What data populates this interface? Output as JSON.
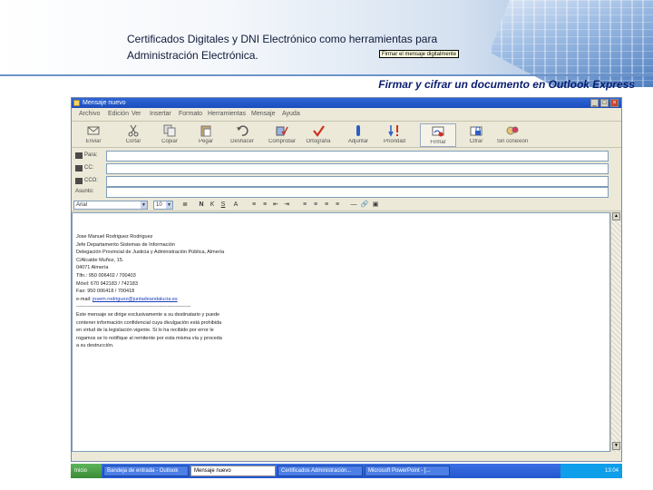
{
  "slide": {
    "title": "Certificados Digitales y DNI Electrónico como herramientas para Administración Electrónica.",
    "subtitle": "Firmar y cifrar un documento en Outlook Express"
  },
  "window": {
    "title": "Mensaje nuevo",
    "menu": [
      "Archivo",
      "Edición",
      "Ver",
      "Insertar",
      "Formato",
      "Herramientas",
      "Mensaje",
      "Ayuda"
    ],
    "toolbar": [
      {
        "label": "Enviar",
        "icon": "send-icon"
      },
      {
        "label": "Cortar",
        "icon": "scissors-icon"
      },
      {
        "label": "Copiar",
        "icon": "copy-icon"
      },
      {
        "label": "Pegar",
        "icon": "paste-icon"
      },
      {
        "label": "Deshacer",
        "icon": "undo-icon"
      },
      {
        "label": "Comprobar",
        "icon": "check-names-icon"
      },
      {
        "label": "Ortografía",
        "icon": "spelling-icon"
      },
      {
        "label": "Adjuntar",
        "icon": "attach-icon"
      },
      {
        "label": "Prioridad",
        "icon": "priority-icon"
      },
      {
        "label": "Firmar",
        "icon": "sign-icon"
      },
      {
        "label": "Cifrar",
        "icon": "encrypt-icon"
      },
      {
        "label": "Sin conexión",
        "icon": "offline-icon"
      }
    ],
    "tooltip": "Firmar el mensaje digitalmente",
    "fields": [
      {
        "label": "Para:",
        "value": ""
      },
      {
        "label": "CC:",
        "value": ""
      },
      {
        "label": "CCO:",
        "value": ""
      },
      {
        "label": "Asunto:",
        "value": ""
      }
    ],
    "format": {
      "font": "Arial",
      "size": "10"
    },
    "body": {
      "name": "Jose Manuel Rodriguez Rodriguez",
      "lines": [
        "Jefe Departamento Sistemas de Información",
        "Delegación Provincial de Justicia y Administración Pública, Almería",
        "C/Alcalde Muñoz, 15.",
        "04071 Almería",
        "Tlfn.: 950 006402 / 700403",
        "Móvil: 670 942183 / 742183",
        "Fax: 950 006418 / 700418"
      ],
      "email_label": "e-mail:",
      "email": "josem.rodriguez@juntadeandalucia.es",
      "separator": "---------------------------------------------------------------------",
      "disclaimer": [
        "Este mensaje se dirige exclusivamente a su destinatario y puede",
        "contener información confidencial cuya divulgación está prohibida",
        "en virtud de la legislación vigente. Si lo ha recibido por error le",
        "rogamos se lo notifique al remitente por esta misma vía y proceda",
        "a su destrucción."
      ]
    }
  },
  "taskbar": {
    "start": "Inicio",
    "tasks": [
      "Bandeja de entrada - Outlook",
      "Mensaje nuevo",
      "Certificados Administración...",
      "Microsoft PowerPoint - [..."
    ],
    "active_index": 1,
    "clock": "13:04"
  }
}
